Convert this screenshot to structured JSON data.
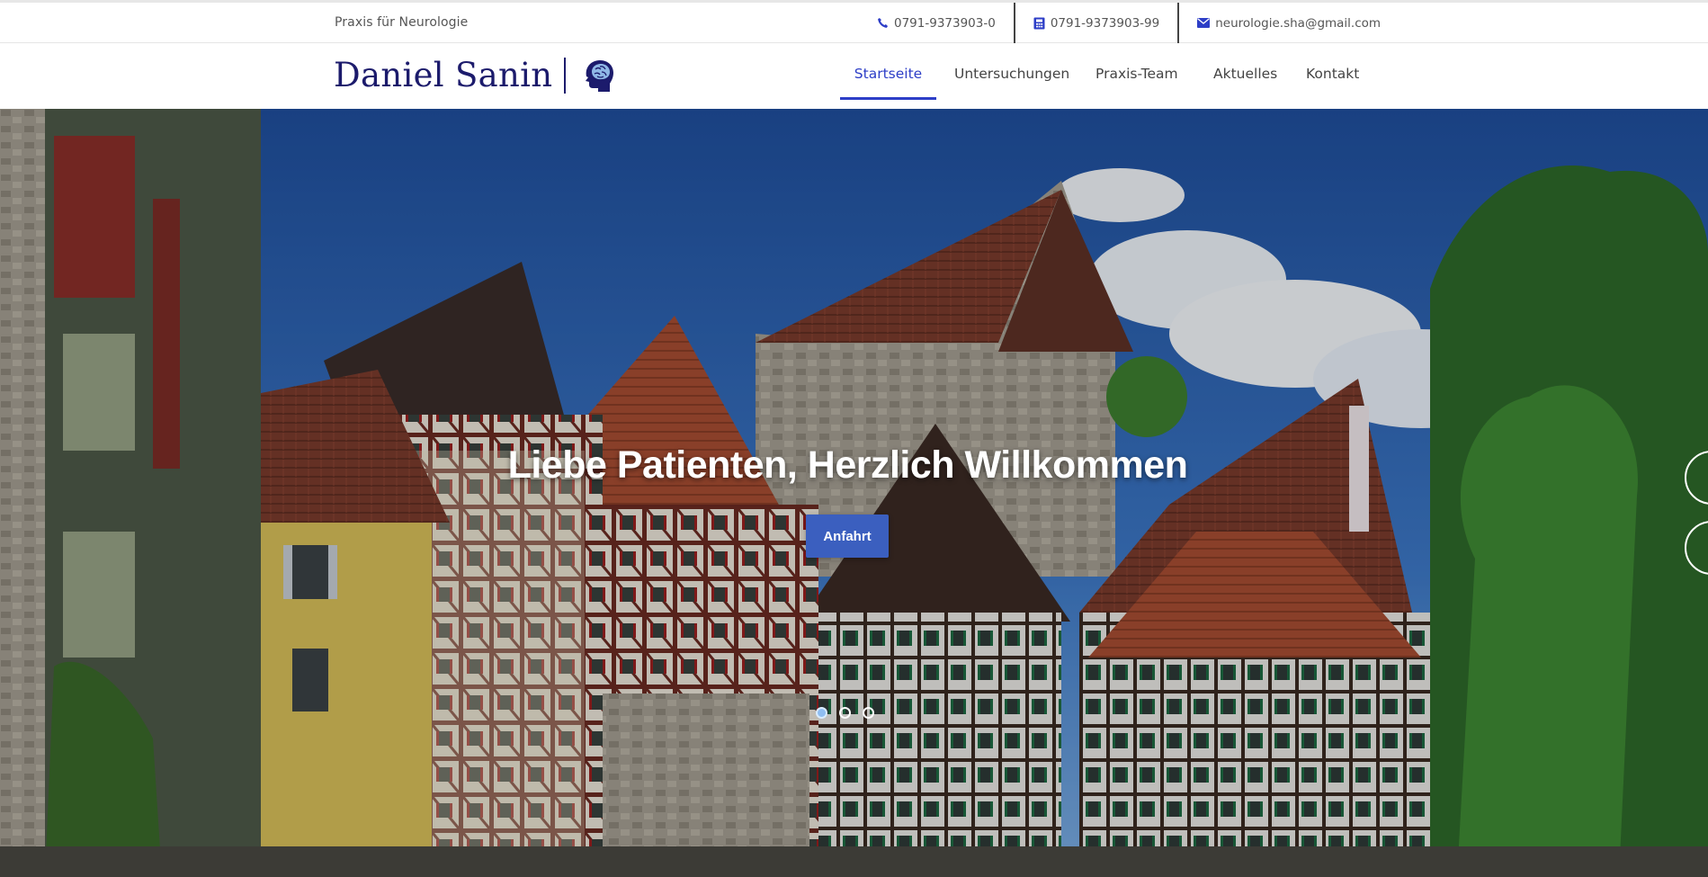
{
  "topbar": {
    "tagline": "Praxis für Neurologie",
    "phone": "0791-9373903-0",
    "fax": "0791-9373903-99",
    "email": "neurologie.sha@gmail.com"
  },
  "brand": {
    "name": "Daniel Sanin",
    "logo_icon": "brain-head-icon"
  },
  "nav": {
    "items": [
      {
        "label": "Startseite",
        "active": true
      },
      {
        "label": "Untersuchungen",
        "active": false
      },
      {
        "label": "Praxis-Team",
        "active": false
      },
      {
        "label": "Aktuelles",
        "active": false
      },
      {
        "label": "Kontakt",
        "active": false
      }
    ]
  },
  "hero": {
    "title": "Liebe Patienten, Herzlich Willkommen",
    "button_label": "Anfahrt",
    "slides_count": 3,
    "active_slide": 1
  },
  "colors": {
    "brand": "#1c1b6c",
    "accent": "#2d3ec7",
    "button": "#3b5fbf"
  }
}
